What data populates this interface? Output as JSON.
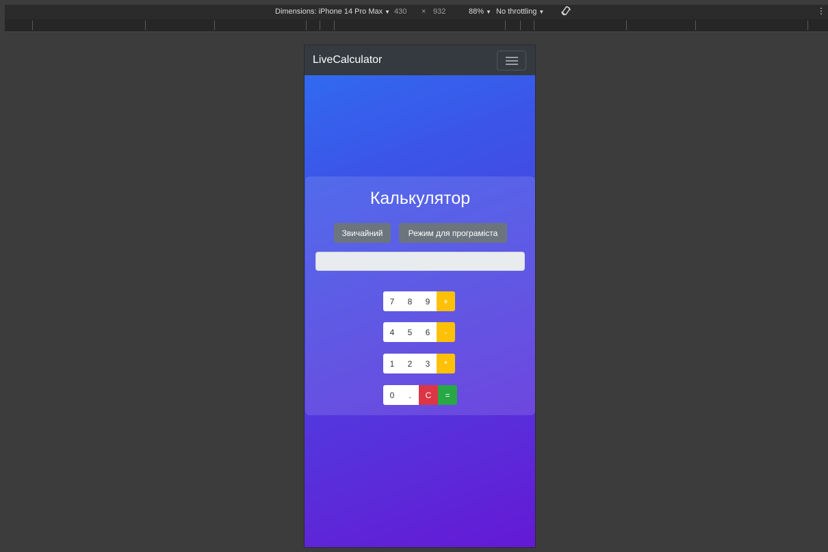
{
  "devtools": {
    "dimensions_label": "Dimensions: iPhone 14 Pro Max",
    "width": "430",
    "times": "×",
    "height": "932",
    "zoom": "88%",
    "throttling": "No throttling",
    "caret": "▼",
    "more": "⋮",
    "rotate_icon": "rotate-icon"
  },
  "navbar": {
    "brand": "LiveCalculator",
    "toggler_icon": "hamburger-icon"
  },
  "calculator": {
    "title": "Калькулятор",
    "modes": [
      "Звичайний",
      "Режим для програміста"
    ],
    "display_value": "",
    "rows": [
      [
        {
          "label": "7",
          "kind": "num"
        },
        {
          "label": "8",
          "kind": "num"
        },
        {
          "label": "9",
          "kind": "num"
        },
        {
          "label": "+",
          "kind": "op"
        }
      ],
      [
        {
          "label": "4",
          "kind": "num"
        },
        {
          "label": "5",
          "kind": "num"
        },
        {
          "label": "6",
          "kind": "num"
        },
        {
          "label": "-",
          "kind": "op"
        }
      ],
      [
        {
          "label": "1",
          "kind": "num"
        },
        {
          "label": "2",
          "kind": "num"
        },
        {
          "label": "3",
          "kind": "num"
        },
        {
          "label": "*",
          "kind": "op"
        }
      ],
      [
        {
          "label": "0",
          "kind": "num"
        },
        {
          "label": ".",
          "kind": "num"
        },
        {
          "label": "C",
          "kind": "clr"
        },
        {
          "label": "=",
          "kind": "eq"
        }
      ]
    ]
  },
  "colors": {
    "operator": "#ffc107",
    "clear": "#dc3545",
    "equals": "#28a745",
    "mode_button": "#6c757d",
    "navbar": "#343a40"
  }
}
